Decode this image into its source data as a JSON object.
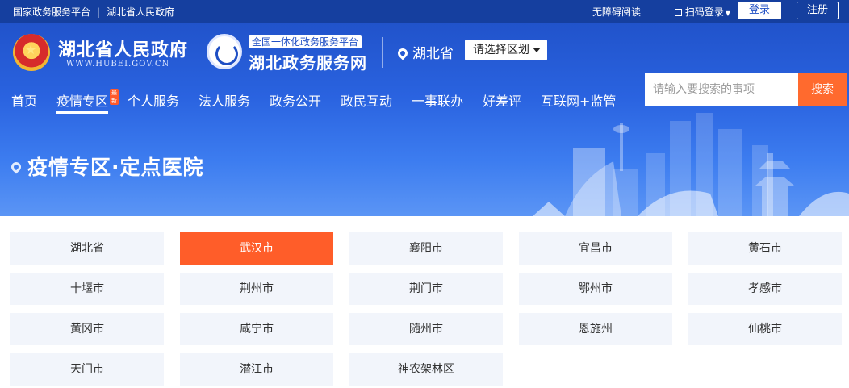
{
  "topbar": {
    "link_national": "国家政务服务平台",
    "link_province": "湖北省人民政府",
    "accessibility": "无障碍阅读",
    "scan_login": "扫码登录",
    "login": "登录",
    "register": "注册"
  },
  "header": {
    "site_name": "湖北省人民政府",
    "site_url": "WWW.HUBEI.GOV.CN",
    "platform_badge": "全国一体化政务服务平台",
    "service_name": "湖北政务服务网",
    "location": "湖北省",
    "region_select": "请选择区划"
  },
  "nav": {
    "items": [
      "首页",
      "疫情专区",
      "个人服务",
      "法人服务",
      "政务公开",
      "政民互动",
      "一事联办",
      "好差评",
      "互联网+监管"
    ],
    "new_tag": "最新",
    "active": "疫情专区"
  },
  "search": {
    "placeholder": "请输入要搜索的事项",
    "button": "搜索"
  },
  "banner": {
    "title": "疫情专区·定点医院"
  },
  "cities": {
    "active": "武汉市",
    "items": [
      "湖北省",
      "武汉市",
      "襄阳市",
      "宜昌市",
      "黄石市",
      "十堰市",
      "荆州市",
      "荆门市",
      "鄂州市",
      "孝感市",
      "黄冈市",
      "咸宁市",
      "随州市",
      "恩施州",
      "仙桃市",
      "天门市",
      "潜江市",
      "神农架林区"
    ]
  }
}
